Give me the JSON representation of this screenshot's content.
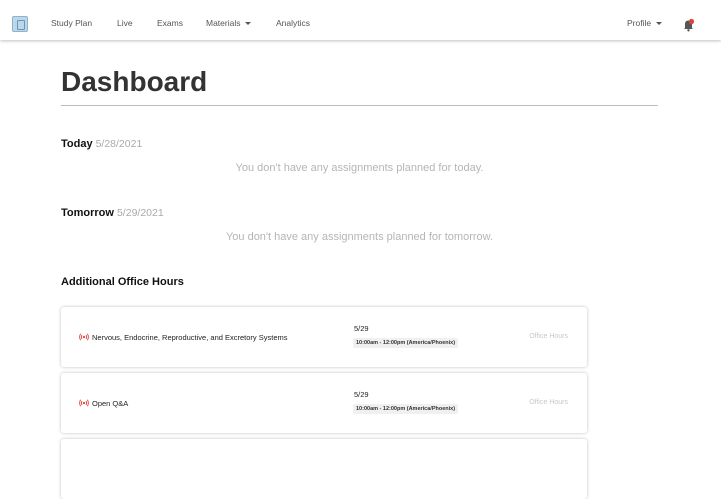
{
  "nav": {
    "items": [
      {
        "label": "Study Plan"
      },
      {
        "label": "Live"
      },
      {
        "label": "Exams"
      },
      {
        "label": "Materials"
      },
      {
        "label": "Analytics"
      }
    ],
    "profile_label": "Profile"
  },
  "page": {
    "title": "Dashboard"
  },
  "today": {
    "label": "Today",
    "date": "5/28/2021",
    "empty_message": "You don't have any assignments planned for today."
  },
  "tomorrow": {
    "label": "Tomorrow",
    "date": "5/29/2021",
    "empty_message": "You don't have any assignments planned for tomorrow."
  },
  "office_hours": {
    "heading": "Additional Office Hours",
    "items": [
      {
        "title": "Nervous, Endocrine, Reproductive, and Excretory Systems",
        "date": "5/29",
        "time": "10:00am - 12:00pm (America/Phoenix)",
        "type": "Office Hours"
      },
      {
        "title": "Open Q&A",
        "date": "5/29",
        "time": "10:00am - 12:00pm (America/Phoenix)",
        "type": "Office Hours"
      }
    ]
  },
  "colors": {
    "live_icon": "#e0443a",
    "bell_badge": "#d9453a"
  },
  "icons": {
    "logo": "logo-icon",
    "materials_caret": "chevron-down-icon",
    "profile_caret": "chevron-down-icon",
    "notifications": "bell-icon",
    "live": "broadcast-icon"
  }
}
